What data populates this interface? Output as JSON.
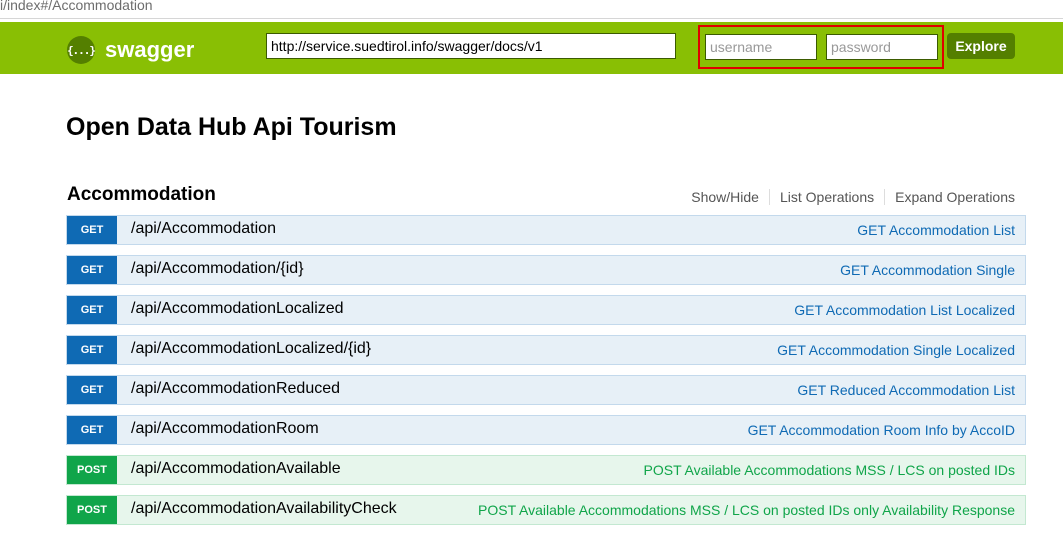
{
  "browser": {
    "url_fragment": "i/index#/Accommodation"
  },
  "header": {
    "logo_icon": "{...}",
    "logo_text": "swagger",
    "api_url": "http://service.suedtirol.info/swagger/docs/v1",
    "username_placeholder": "username",
    "password_placeholder": "password",
    "explore_label": "Explore"
  },
  "page": {
    "title": "Open Data Hub Api Tourism"
  },
  "resource": {
    "name": "Accommodation",
    "options": {
      "show_hide": "Show/Hide",
      "list_operations": "List Operations",
      "expand_operations": "Expand Operations"
    },
    "operations": [
      {
        "method": "GET",
        "path": "/api/Accommodation",
        "summary": "GET Accommodation List"
      },
      {
        "method": "GET",
        "path": "/api/Accommodation/{id}",
        "summary": "GET Accommodation Single"
      },
      {
        "method": "GET",
        "path": "/api/AccommodationLocalized",
        "summary": "GET Accommodation List Localized"
      },
      {
        "method": "GET",
        "path": "/api/AccommodationLocalized/{id}",
        "summary": "GET Accommodation Single Localized"
      },
      {
        "method": "GET",
        "path": "/api/AccommodationReduced",
        "summary": "GET Reduced Accommodation List"
      },
      {
        "method": "GET",
        "path": "/api/AccommodationRoom",
        "summary": "GET Accommodation Room Info by AccoID"
      },
      {
        "method": "POST",
        "path": "/api/AccommodationAvailable",
        "summary": "POST Available Accommodations MSS / LCS on posted IDs"
      },
      {
        "method": "POST",
        "path": "/api/AccommodationAvailabilityCheck",
        "summary": "POST Available Accommodations MSS / LCS on posted IDs only Availability Response"
      }
    ]
  },
  "colors": {
    "header_bg": "#89bf04",
    "explore_bg": "#547f00",
    "get_method": "#0f6ab4",
    "post_method": "#10a54a",
    "highlight_border": "#e00000"
  }
}
